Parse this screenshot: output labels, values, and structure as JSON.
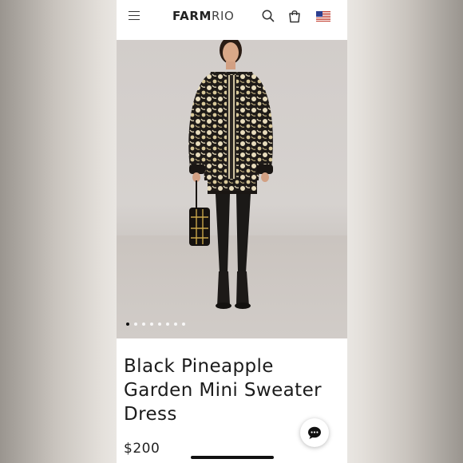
{
  "header": {
    "logo_bold": "FARM",
    "logo_light": "RIO",
    "icons": [
      "menu-icon",
      "search-icon",
      "shopping-bag-icon",
      "us-flag-icon"
    ]
  },
  "product": {
    "title": "Black Pineapple Garden Mini Sweater Dress",
    "price": "$200"
  },
  "carousel": {
    "total_slides": 8,
    "active_slide": 1
  },
  "chat_widget": {
    "icon": "chat-bubble-icon"
  },
  "colors": {
    "text": "#1b1b1b",
    "dress_black": "#1f1b18",
    "dress_cream": "#e8dcbc",
    "backdrop": "#d2cdca"
  }
}
